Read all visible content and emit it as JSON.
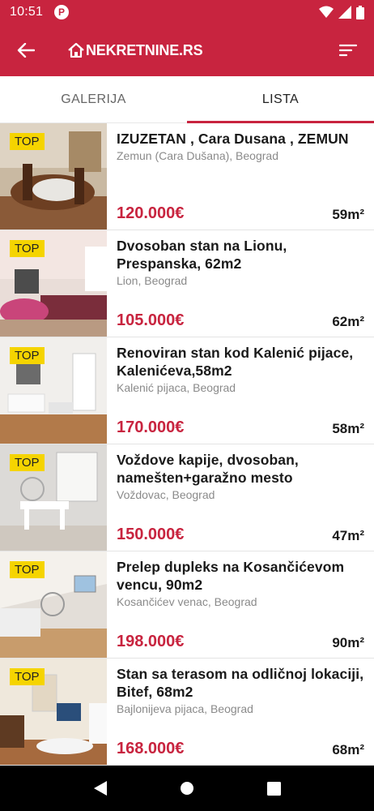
{
  "status_bar": {
    "time": "10:51",
    "app_badge": "P"
  },
  "app_bar": {
    "logo_text": "NEKRETNINE.RS"
  },
  "tabs": [
    {
      "label": "GALERIJA"
    },
    {
      "label": "LISTA"
    }
  ],
  "listings": [
    {
      "badge": "TOP",
      "title": "IZUZETAN , Cara Dusana , ZEMUN",
      "location": "Zemun (Cara Dušana), Beograd",
      "price": "120.000€",
      "area": "59m²"
    },
    {
      "badge": "TOP",
      "title": "Dvosoban stan na Lionu, Prespanska, 62m2",
      "location": "Lion, Beograd",
      "price": "105.000€",
      "area": "62m²"
    },
    {
      "badge": "TOP",
      "title": "Renoviran stan kod Kalenić pijace, Kalenićeva,58m2",
      "location": "Kalenić pijaca, Beograd",
      "price": "170.000€",
      "area": "58m²"
    },
    {
      "badge": "TOP",
      "title": "Voždove kapije, dvosoban, namešten+garažno mesto",
      "location": "Voždovac, Beograd",
      "price": "150.000€",
      "area": "47m²"
    },
    {
      "badge": "TOP",
      "title": "Prelep dupleks na Kosančićevom vencu, 90m2",
      "location": "Kosančićev venac, Beograd",
      "price": "198.000€",
      "area": "90m²"
    },
    {
      "badge": "TOP",
      "title": "Stan sa terasom na odličnoj lokaciji, Bitef, 68m2",
      "location": "Bajlonijeva pijaca, Beograd",
      "price": "168.000€",
      "area": "68m²"
    }
  ],
  "colors": {
    "brand": "#c8243f",
    "badge": "#f5d400"
  }
}
